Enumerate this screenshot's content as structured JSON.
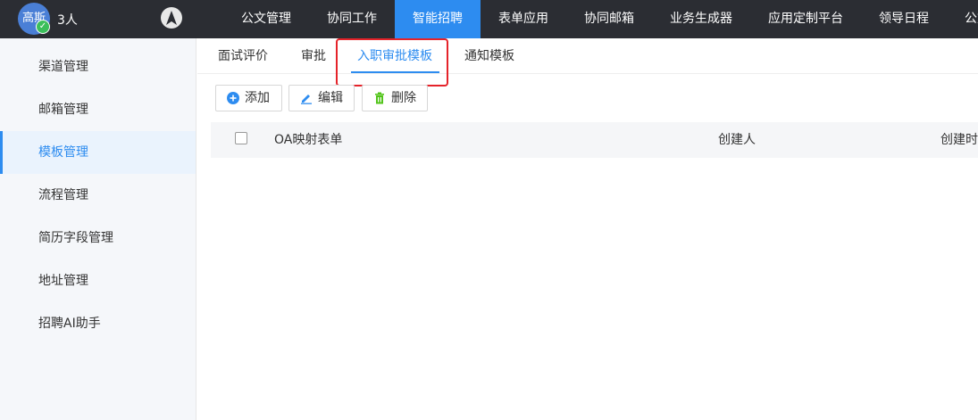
{
  "header": {
    "avatar_text": "高斯",
    "user_count": "3人",
    "nav": [
      "公文管理",
      "协同工作",
      "智能招聘",
      "表单应用",
      "协同邮箱",
      "业务生成器",
      "应用定制平台",
      "领导日程",
      "公文"
    ],
    "active_nav_index": 2
  },
  "sidebar": {
    "items": [
      "渠道管理",
      "邮箱管理",
      "模板管理",
      "流程管理",
      "简历字段管理",
      "地址管理",
      "招聘AI助手"
    ],
    "active_index": 2
  },
  "tabs": {
    "items": [
      "面试评价",
      "审批",
      "入职审批模板",
      "通知模板"
    ],
    "active_index": 2
  },
  "toolbar": {
    "add_label": "添加",
    "edit_label": "编辑",
    "delete_label": "删除"
  },
  "table": {
    "columns": [
      "OA映射表单",
      "创建人",
      "创建时"
    ]
  },
  "colors": {
    "accent": "#2d8cf0",
    "topbar": "#2b2d33",
    "highlight": "#e5232a",
    "delete_icon": "#52c41a"
  }
}
